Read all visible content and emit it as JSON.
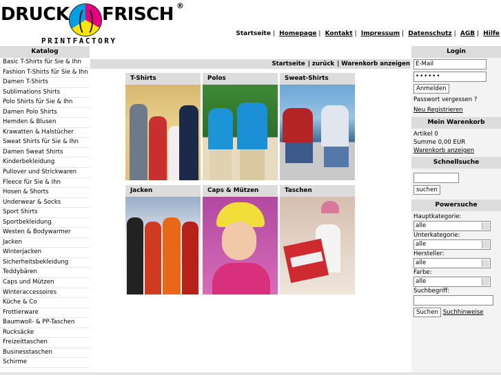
{
  "logo": {
    "word1": "DRUCK",
    "word2": "FRISCH",
    "reg": "®",
    "tagline": "PRINTFACTORY"
  },
  "topnav": [
    "Startseite",
    "Homepage",
    "Kontakt",
    "Impressum",
    "Datenschutz",
    "AGB",
    "Hilfe"
  ],
  "catalog": {
    "title": "Katalog",
    "items": [
      "Basic T-Shirts für Sie & Ihn",
      "Fashion T-Shirts für Sie & Ihn",
      "Damen T-Shirts",
      "Sublimations Shirts",
      "Polo Shirts für Sie & Ihn",
      "Damen Polo Shirts",
      "Hemden & Blusen",
      "Krawatten & Halstücher",
      "Sweat Shirts für Sie & Ihn",
      "Damen Sweat Shirts",
      "Kinderbekleidung",
      "Pullover und Strickwaren",
      "Fleece für Sie & Ihn",
      "Hosen & Shorts",
      "Underwear & Socks",
      "Sport Shirts",
      "Sportbekleidung",
      "Westen & Bodywarmer",
      "Jacken",
      "Winterjacken",
      "Sicherheitsbekleidung",
      "Teddybären",
      "Caps und Mützen",
      "Winteraccessoires",
      "Küche & Co",
      "Frottierware",
      "Baumwoll- & PP-Taschen",
      "Rucksäcke",
      "Freizeittaschen",
      "Businesstaschen",
      "Schirme"
    ]
  },
  "breadcrumb": {
    "startseite": "Startseite",
    "back": "zurück",
    "cart": "Warenkorb anzeigen"
  },
  "tiles": [
    "T-Shirts",
    "Polos",
    "Sweat-Shirts",
    "Jacken",
    "Caps & Mützen",
    "Taschen"
  ],
  "login": {
    "title": "Login",
    "email": "E-Mail",
    "password": "••••••",
    "button": "Anmelden",
    "forgot": "Passwort vergessen ?",
    "register": "Neu Registrieren"
  },
  "cart": {
    "title": "Mein Warenkorb",
    "items": "Artikel 0",
    "sum": "Summe 0,00 EUR",
    "show": "Warenkorb anzeigen"
  },
  "quicksearch": {
    "title": "Schnellsuche",
    "button": "suchen"
  },
  "powersearch": {
    "title": "Powersuche",
    "main_cat_label": "Hauptkategorie:",
    "main_cat_value": "alle",
    "sub_cat_label": "Unterkategorie:",
    "sub_cat_value": "alle",
    "maker_label": "Hersteller:",
    "maker_value": "alle",
    "color_label": "Farbe:",
    "color_value": "alle",
    "term_label": "Suchbegriff:",
    "button": "Suchen",
    "hints": "Suchhinweise"
  }
}
